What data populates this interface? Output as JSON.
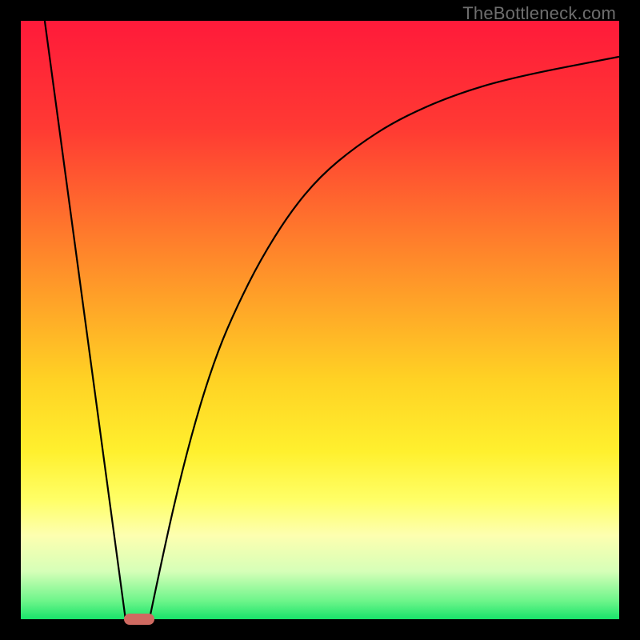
{
  "watermark": "TheBottleneck.com",
  "chart_data": {
    "type": "line",
    "title": "",
    "xlabel": "",
    "ylabel": "",
    "xlim": [
      0,
      100
    ],
    "ylim": [
      0,
      100
    ],
    "grid": false,
    "legend": false,
    "gradient_stops": [
      {
        "offset": 0.0,
        "color": "#ff1a3a"
      },
      {
        "offset": 0.18,
        "color": "#ff3a33"
      },
      {
        "offset": 0.4,
        "color": "#ff8a2a"
      },
      {
        "offset": 0.6,
        "color": "#ffd224"
      },
      {
        "offset": 0.72,
        "color": "#fff02e"
      },
      {
        "offset": 0.8,
        "color": "#ffff66"
      },
      {
        "offset": 0.86,
        "color": "#fdffb0"
      },
      {
        "offset": 0.92,
        "color": "#d6ffb8"
      },
      {
        "offset": 0.97,
        "color": "#6cf58a"
      },
      {
        "offset": 1.0,
        "color": "#18e36a"
      }
    ],
    "series": [
      {
        "name": "left-v",
        "x": [
          4.0,
          17.5
        ],
        "y": [
          100.0,
          0.0
        ]
      },
      {
        "name": "right-curve",
        "x": [
          21.5,
          24.0,
          27.0,
          30.0,
          33.0,
          36.0,
          40.0,
          45.0,
          50.0,
          56.0,
          63.0,
          72.0,
          82.0,
          100.0
        ],
        "y": [
          0.0,
          12.0,
          25.0,
          36.0,
          45.0,
          52.0,
          60.0,
          68.0,
          74.0,
          79.0,
          83.5,
          87.5,
          90.5,
          94.0
        ]
      }
    ],
    "marker": {
      "x_start": 17.3,
      "x_end": 22.3,
      "y": 0.0,
      "color": "#cf6a61"
    }
  }
}
